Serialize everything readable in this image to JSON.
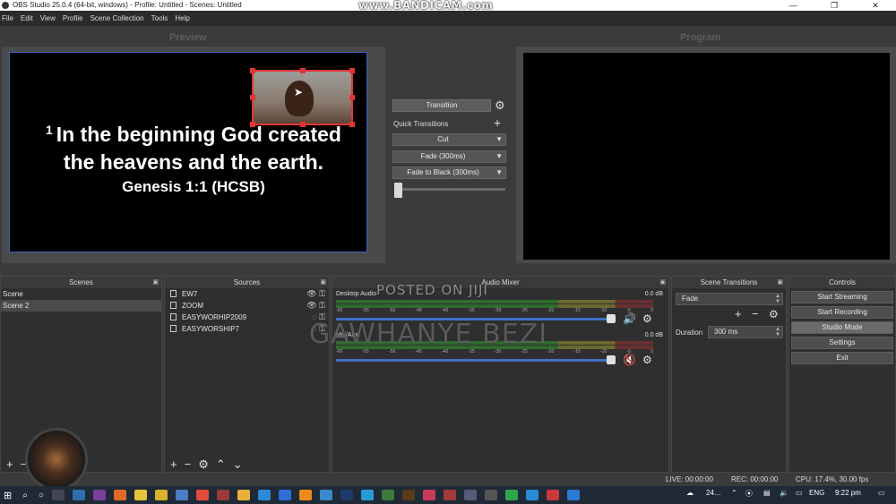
{
  "window": {
    "title": "OBS Studio 25.0.4 (64-bit, windows) - Profile: Untitled - Scenes: Untitled",
    "minimize": "—",
    "maximize": "❐",
    "close": "✕",
    "watermark": "www.BANDICAM.com"
  },
  "menu": [
    "File",
    "Edit",
    "View",
    "Profile",
    "Scene Collection",
    "Tools",
    "Help"
  ],
  "preview": {
    "label": "Preview",
    "verse_number": "1",
    "verse_line1": "In the beginning God created",
    "verse_line2": "the heavens and the earth.",
    "reference": "Genesis 1:1 (HCSB)"
  },
  "program": {
    "label": "Program"
  },
  "transitions_panel": {
    "transition_button": "Transition",
    "quick_transitions_label": "Quick Transitions",
    "options": [
      "Cut",
      "Fade (300ms)",
      "Fade to Black (300ms)"
    ],
    "tbar_position": 0.0
  },
  "scenes": {
    "title": "Scenes",
    "items": [
      "Scene",
      "Scene 2"
    ],
    "selected_index": 1
  },
  "sources": {
    "title": "Sources",
    "items": [
      "EW7",
      "ZOOM",
      "EASYWORHIP2009",
      "EASYWORSHIP7"
    ]
  },
  "mixer": {
    "title": "Audio Mixer",
    "channels": [
      {
        "name": "Desktop Audio",
        "db": "0.0 dB",
        "muted": false,
        "volume": 1.0
      },
      {
        "name": "Mic/Aux",
        "db": "0.0 dB",
        "muted": true,
        "volume": 1.0
      }
    ],
    "ticks": [
      "-60",
      "-55",
      "-50",
      "-45",
      "-40",
      "-35",
      "-30",
      "-25",
      "-20",
      "-15",
      "-10",
      "-5",
      "0"
    ]
  },
  "scene_transitions": {
    "title": "Scene Transitions",
    "selected": "Fade",
    "duration_label": "Duration",
    "duration_value": "300 ms"
  },
  "controls": {
    "title": "Controls",
    "buttons": [
      "Start Streaming",
      "Start Recording",
      "Studio Mode",
      "Settings",
      "Exit"
    ]
  },
  "status": {
    "live": "LIVE: 00:00:00",
    "rec": "REC: 00:00:00",
    "cpu": "CPU: 17.4%, 30.00 fps"
  },
  "overlays": {
    "posted": "POSTED ON JIJI",
    "author": "GAWHANYE BEZI"
  },
  "taskbar": {
    "weather": "24…",
    "lang": "ENG",
    "time": "9:22 pm"
  },
  "colors": {
    "accent_blue": "#3f6fc9",
    "selection_red": "#e23434",
    "meter_green": "#2f6a2f",
    "muted_red": "#d23a3a"
  }
}
